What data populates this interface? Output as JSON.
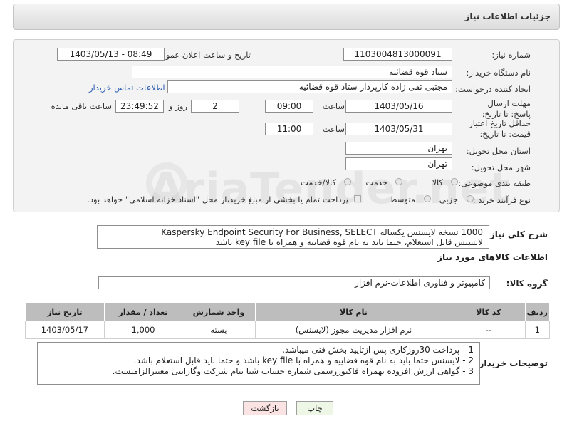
{
  "header": {
    "title": "جزئیات اطلاعات نیاز"
  },
  "form": {
    "need_number_label": "شماره نیاز:",
    "need_number": "1103004813000091",
    "announce_label": "تاریخ و ساعت اعلان عمومی:",
    "announce_value": "1403/05/13 - 08:49",
    "buyer_org_label": "نام دستگاه خریدار:",
    "buyer_org": "ستاد قوه قضائیه",
    "requester_label": "ایجاد کننده درخواست:",
    "requester": "مجتبی تقی زاده کارپرداز ستاد قوه قضائیه",
    "contact_link": "اطلاعات تماس خریدار",
    "deadline_label": "مهلت ارسال پاسخ: تا تاریخ:",
    "deadline_date": "1403/05/16",
    "time_label": "ساعت",
    "deadline_time": "09:00",
    "days_value": "2",
    "days_label": "روز و",
    "remaining_time": "23:49:52",
    "remaining_label": "ساعت باقی مانده",
    "validity_label": "حداقل تاریخ اعتبار قیمت: تا تاریخ:",
    "validity_date": "1403/05/31",
    "validity_time_label": "ساعت",
    "validity_time": "11:00",
    "province_label": "استان محل تحویل:",
    "province": "تهران",
    "city_label": "شهر محل تحویل:",
    "city": "تهران",
    "category_label": "طبقه بندی موضوعی:",
    "category_options": [
      "کالا",
      "خدمت",
      "کالا/خدمت"
    ],
    "process_label": "نوع فرآیند خرید :",
    "process_options": [
      "جزیی",
      "متوسط"
    ],
    "payment_text": "پرداخت تمام یا بخشی از مبلغ خرید،از محل \"اسناد خزانه اسلامی\" خواهد بود."
  },
  "description": {
    "label": "شرح کلی نیاز:",
    "line1": "1000 نسخه لایسنس یکساله Kaspersky Endpoint Security For Business, SELECT",
    "line2": "لایسنس قابل استعلام، حتما باید به نام قوه قضاییه و همراه با key file باشد"
  },
  "goods_info": {
    "title": "اطلاعات کالاهای مورد نیاز",
    "group_label": "گروه کالا:",
    "group_value": "کامپیوتر و فناوری اطلاعات-نرم افزار"
  },
  "table": {
    "headers": [
      "ردیف",
      "کد کالا",
      "نام کالا",
      "واحد شمارش",
      "تعداد / مقدار",
      "تاریخ نیاز"
    ],
    "rows": [
      [
        "1",
        "--",
        "نرم افزار مدیریت مجوز (لایسنس)",
        "بسته",
        "1,000",
        "1403/05/17"
      ]
    ]
  },
  "notes": {
    "label": "توضیحات خریدار:",
    "lines": [
      "1 - پرداخت 30روزکاری پس ازتایید بخش فنی میباشد.",
      "2 -  لایسنس حتما باید به نام قوه قضاییه و همراه با key file باشد و حتما باید قابل استعلام باشد.",
      "3 - گواهی ارزش افزوده بهمراه فاکتوررسمی شماره حساب شبا بنام شرکت وگارانتی معتبرالزامیست."
    ]
  },
  "buttons": {
    "print": "چاپ",
    "back": "بازگشت"
  },
  "watermark": "AriaTender.net",
  "colors": {
    "link": "#2a5db0",
    "back_button": "#fbe3e3",
    "print_button": "#eef7e6"
  }
}
